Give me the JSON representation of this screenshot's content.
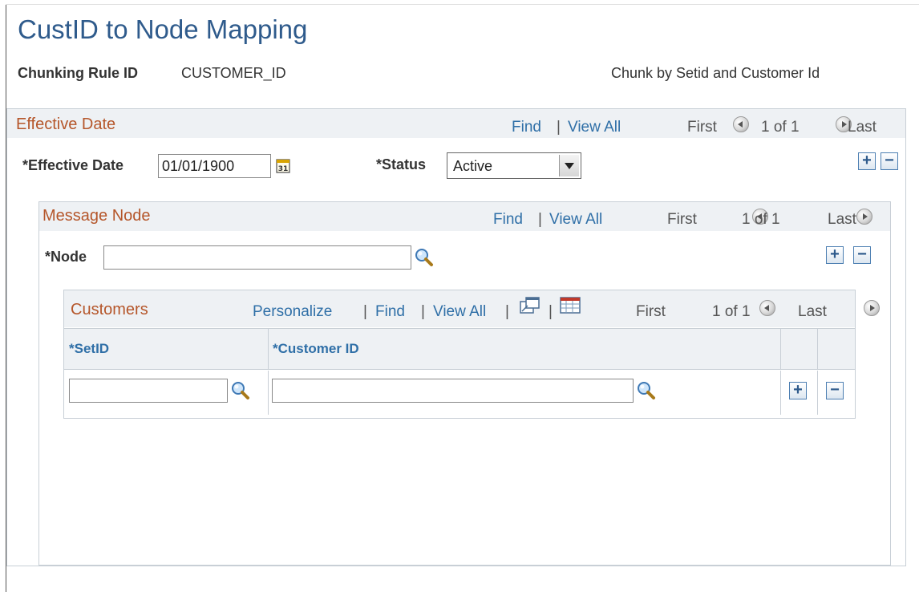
{
  "page": {
    "title": "CustID to Node Mapping",
    "chunking_rule_label": "Chunking Rule ID",
    "chunking_rule_value": "CUSTOMER_ID",
    "description": "Chunk by Setid and Customer Id"
  },
  "effective_date_section": {
    "title": "Effective Date",
    "find": "Find",
    "separator": "|",
    "view_all": "View All",
    "first": "First",
    "count": "1 of 1",
    "last": "Last",
    "date_label": "*Effective Date",
    "date_value": "01/01/1900",
    "status_label": "*Status",
    "status_value": "Active",
    "add": "+",
    "remove": "−"
  },
  "message_node_section": {
    "title": "Message Node",
    "find": "Find",
    "separator": "|",
    "view_all": "View All",
    "first": "First",
    "count": "1 of 1",
    "last": "Last",
    "node_label": "*Node",
    "node_value": "",
    "add": "+",
    "remove": "−"
  },
  "customers_grid": {
    "title": "Customers",
    "personalize": "Personalize",
    "find": "Find",
    "view_all": "View All",
    "separator": "|",
    "first": "First",
    "count": "1 of 1",
    "last": "Last",
    "columns": [
      "*SetID",
      "*Customer ID"
    ],
    "rows": [
      {
        "setid": "",
        "customer_id": ""
      }
    ],
    "add": "+",
    "remove": "−"
  },
  "icons": {
    "calendar": "calendar-icon",
    "lookup": "magnifier-icon",
    "zoom": "new-window-icon",
    "download": "spreadsheet-icon",
    "prev": "previous-circle-icon",
    "next": "next-circle-icon",
    "dropdown": "dropdown-arrow-icon"
  },
  "colors": {
    "title": "#2f5b8c",
    "section_title": "#b5562a",
    "link": "#2f6fa7",
    "band": "#eef1f4",
    "border": "#c8cfd6"
  }
}
